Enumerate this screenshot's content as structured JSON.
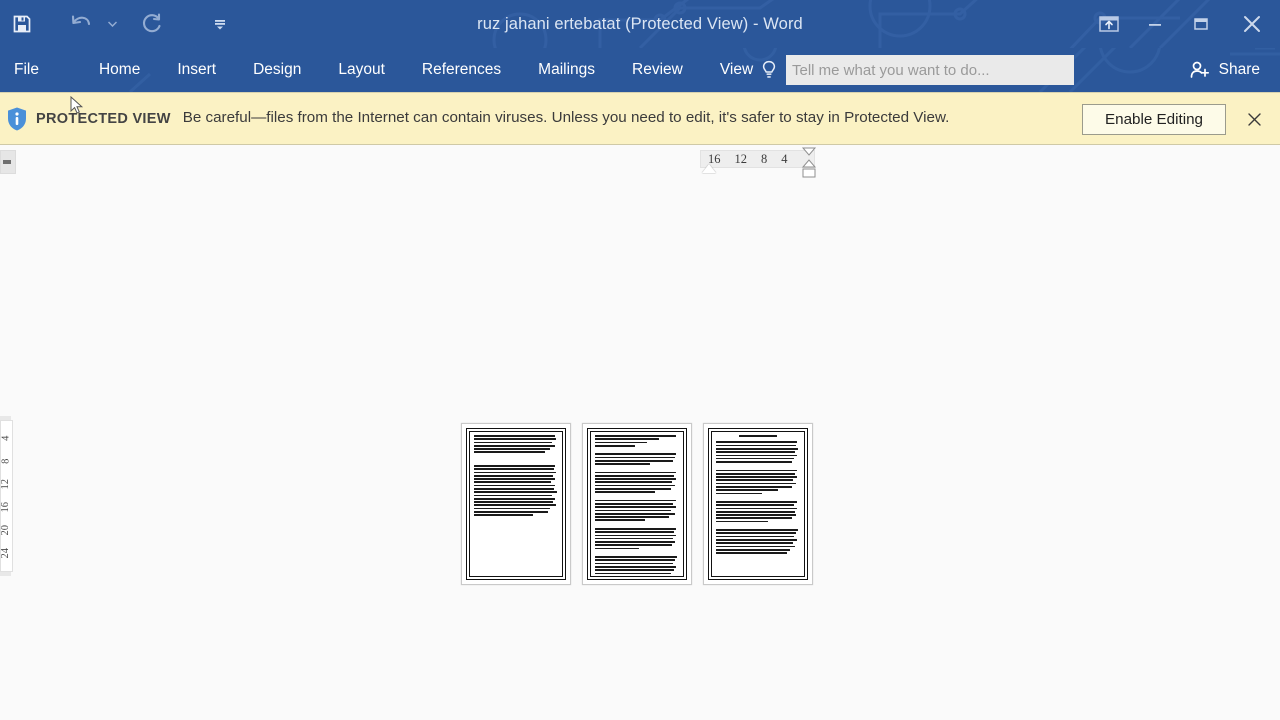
{
  "window": {
    "title": "ruz jahani ertebatat (Protected View) - Word",
    "accent_color": "#2b579a",
    "quick_access": [
      {
        "name": "save-icon",
        "label": "Save"
      },
      {
        "name": "undo-icon",
        "label": "Undo"
      },
      {
        "name": "redo-icon",
        "label": "Repeat"
      },
      {
        "name": "customize-quick-access-toolbar-icon",
        "label": "Customize Quick Access Toolbar"
      }
    ],
    "controls": [
      {
        "name": "ribbon-display-options-icon",
        "label": "Ribbon Display Options"
      },
      {
        "name": "minimize-icon",
        "label": "Minimize"
      },
      {
        "name": "restore-icon",
        "label": "Restore Down"
      },
      {
        "name": "close-icon",
        "label": "Close"
      }
    ]
  },
  "ribbon": {
    "tabs": [
      {
        "label": "File"
      },
      {
        "label": "Home"
      },
      {
        "label": "Insert"
      },
      {
        "label": "Design"
      },
      {
        "label": "Layout"
      },
      {
        "label": "References"
      },
      {
        "label": "Mailings"
      },
      {
        "label": "Review"
      },
      {
        "label": "View"
      }
    ],
    "tellme_placeholder": "Tell me what you want to do...",
    "tellme_value": "",
    "share_label": "Share"
  },
  "protected_view": {
    "badge": "PROTECTED VIEW",
    "message": "Be careful—files from the Internet can contain viruses. Unless you need to edit, it's safer to stay in Protected View.",
    "enable_button": "Enable Editing",
    "close_label": "×",
    "bar_color": "#fbf2c4"
  },
  "rulers": {
    "horizontal_numbers": [
      "16",
      "12",
      "8",
      "4"
    ],
    "vertical_numbers": [
      "4",
      "8",
      "12",
      "16",
      "20",
      "24"
    ]
  },
  "document": {
    "zoom_view": "multiple-pages",
    "pages": [
      {
        "number": "1",
        "has_heading": false,
        "blocks": [
          {
            "type": "para",
            "lines": [
              96,
              98,
              93,
              97,
              90,
              84
            ]
          },
          {
            "type": "gap"
          },
          {
            "type": "para",
            "lines": [
              97,
              95,
              98,
              94,
              96,
              92,
              97,
              95,
              99,
              93,
              96,
              94,
              98,
              91,
              88,
              70
            ]
          }
        ],
        "blank_tail": true
      },
      {
        "number": "2",
        "has_heading": false,
        "blocks": [
          {
            "type": "para",
            "lines": [
              96,
              76,
              62,
              48
            ]
          },
          {
            "type": "para",
            "lines": [
              97,
              95,
              93,
              66
            ]
          },
          {
            "type": "para",
            "lines": [
              96,
              94,
              97,
              92,
              95,
              90,
              72
            ]
          },
          {
            "type": "para",
            "lines": [
              97,
              93,
              96,
              91,
              95,
              88,
              60
            ]
          },
          {
            "type": "para",
            "lines": [
              96,
              94,
              97,
              93,
              95,
              92,
              52
            ]
          },
          {
            "type": "para",
            "lines": [
              98,
              95,
              93,
              96,
              94,
              90,
              86
            ]
          }
        ],
        "blank_tail": false
      },
      {
        "number": "3",
        "has_heading": true,
        "blocks": [
          {
            "type": "para",
            "lines": [
              97,
              95,
              98,
              94,
              96,
              93,
              90
            ]
          },
          {
            "type": "para",
            "lines": [
              96,
              94,
              97,
              92,
              95,
              91,
              74,
              55
            ]
          },
          {
            "type": "para",
            "lines": [
              96,
              93,
              97,
              94,
              95,
              90,
              62
            ]
          },
          {
            "type": "para",
            "lines": [
              98,
              95,
              93,
              96,
              92,
              94,
              88,
              84
            ]
          }
        ],
        "blank_tail": false
      }
    ]
  }
}
